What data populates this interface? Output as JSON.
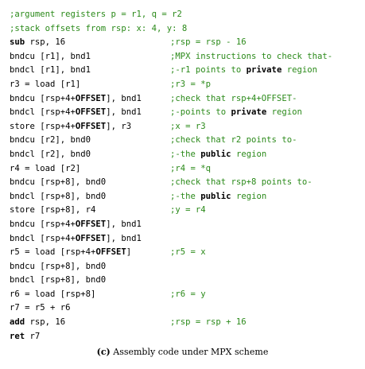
{
  "colors": {
    "comment": "#2b8a1a",
    "code": "#000000"
  },
  "lines": [
    {
      "code": ";argument registers p = r1, q = r2",
      "comment": "",
      "full_comment": true
    },
    {
      "code": ";stack offsets from rsp: x: 4, y: 8",
      "comment": "",
      "full_comment": true
    },
    {
      "code": "sub rsp, 16",
      "comment": ";rsp = rsp - 16"
    },
    {
      "code": "bndcu [r1], bnd1",
      "comment": ";MPX instructions to check that-"
    },
    {
      "code": "bndcl [r1], bnd1",
      "comment": ";-r1 points to private region"
    },
    {
      "code": "r3 = load [r1]",
      "comment": ";r3 = *p"
    },
    {
      "code": "bndcu [rsp+4+OFFSET], bnd1",
      "comment": ";check that rsp+4+OFFSET-"
    },
    {
      "code": "bndcl [rsp+4+OFFSET], bnd1",
      "comment": ";-points to private region"
    },
    {
      "code": "store [rsp+4+OFFSET], r3",
      "comment": ";x = r3"
    },
    {
      "code": "bndcu [r2], bnd0",
      "comment": ";check that r2 points to-"
    },
    {
      "code": "bndcl [r2], bnd0",
      "comment": ";-the public region"
    },
    {
      "code": "r4 = load [r2]",
      "comment": ";r4 = *q"
    },
    {
      "code": "bndcu [rsp+8], bnd0",
      "comment": ";check that rsp+8 points to-"
    },
    {
      "code": "bndcl [rsp+8], bnd0",
      "comment": ";-the public region"
    },
    {
      "code": "store [rsp+8], r4",
      "comment": ";y = r4"
    },
    {
      "code": "bndcu [rsp+4+OFFSET], bnd1",
      "comment": ""
    },
    {
      "code": "bndcl [rsp+4+OFFSET], bnd1",
      "comment": ""
    },
    {
      "code": "r5 = load [rsp+4+OFFSET]",
      "comment": ";r5 = x"
    },
    {
      "code": "bndcu [rsp+8], bnd0",
      "comment": ""
    },
    {
      "code": "bndcl [rsp+8], bnd0",
      "comment": ""
    },
    {
      "code": "r6 = load [rsp+8]",
      "comment": ";r6 = y"
    },
    {
      "code": "r7 = r5 + r6",
      "comment": ""
    },
    {
      "code": "add rsp, 16",
      "comment": ";rsp = rsp + 16"
    },
    {
      "code": "ret r7",
      "comment": ""
    }
  ],
  "caption": {
    "tag": "(c)",
    "text": "Assembly code under MPX scheme"
  }
}
